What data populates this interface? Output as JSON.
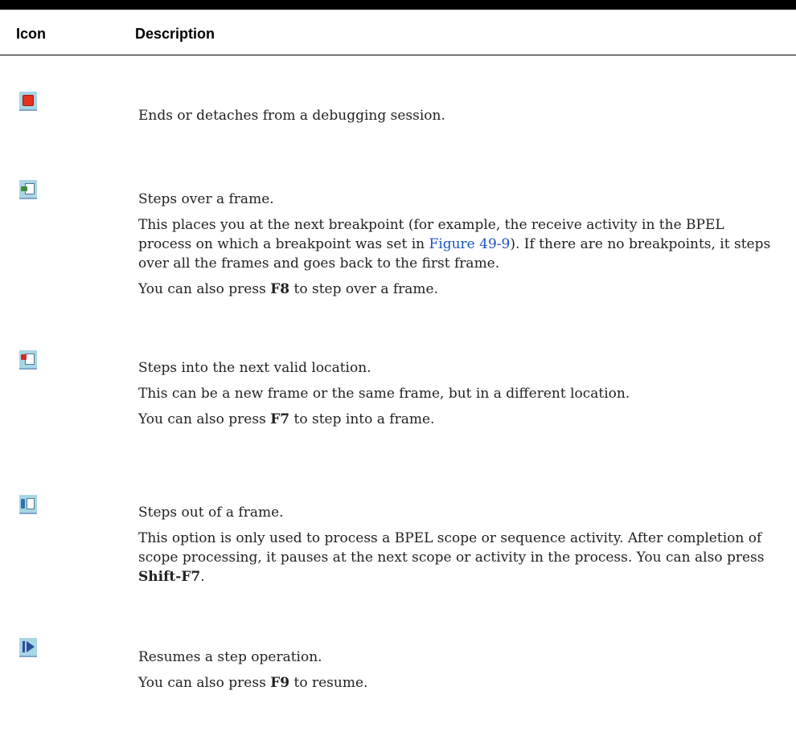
{
  "table": {
    "header": {
      "icon": "Icon",
      "description": "Description"
    },
    "rows": [
      {
        "icon": "stop-icon",
        "lines": [
          "Ends or detaches from a debugging session."
        ]
      },
      {
        "icon": "step-over-icon",
        "lines": [
          "Steps over a frame."
        ],
        "para2_pre": "This places you at the next breakpoint (for example, the receive activity in the BPEL process on which a breakpoint was set in ",
        "para2_link": "Figure 49-9",
        "para2_post": "). If there are no breakpoints, it steps over all the frames and goes back to the first frame.",
        "press_pre": "You can also press ",
        "press_key": "F8",
        "press_post": " to step over a frame."
      },
      {
        "icon": "step-into-icon",
        "lines": [
          "Steps into the next valid location.",
          "This can be a new frame or the same frame, but in a different location."
        ],
        "press_pre": "You can also press ",
        "press_key": "F7",
        "press_post": " to step into a frame."
      },
      {
        "icon": "step-out-icon",
        "lines": [
          "Steps out of a frame."
        ],
        "para2_pre": "This option is only used to process a BPEL scope or sequence activity. After completion of scope processing, it pauses at the next scope or activity in the process. You can also press ",
        "para2_key": "Shift-F7",
        "para2_post": "."
      },
      {
        "icon": "resume-icon",
        "lines": [
          "Resumes a step operation."
        ],
        "press_pre": "You can also press ",
        "press_key": "F9",
        "press_post": " to resume."
      }
    ]
  }
}
